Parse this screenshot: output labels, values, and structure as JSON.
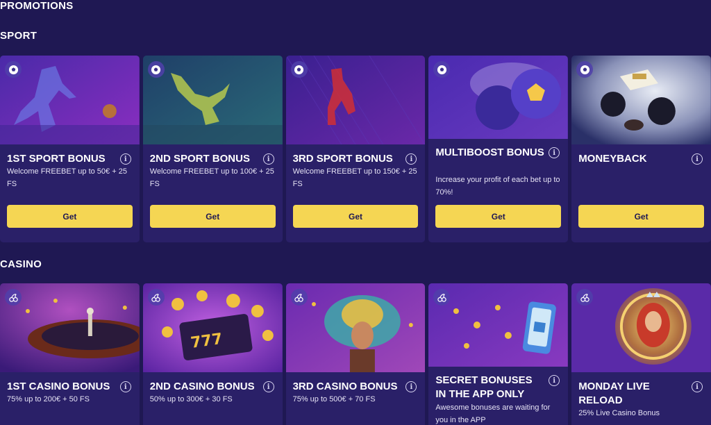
{
  "page": {
    "title": "PROMOTIONS"
  },
  "sport": {
    "title": "SPORT",
    "cards": [
      {
        "title": "1ST SPORT BONUS",
        "desc": "Welcome FREEBET up to 50€ + 25 FS",
        "button": "Get"
      },
      {
        "title": "2ND SPORT BONUS",
        "desc": "Welcome FREEBET up to 100€ + 25 FS",
        "button": "Get"
      },
      {
        "title": "3RD SPORT BONUS",
        "desc": "Welcome FREEBET up to 150€ + 25 FS",
        "button": "Get"
      },
      {
        "title": "MULTIBOOST BONUS",
        "desc": "Increase your profit of each bet up to 70%!",
        "button": "Get"
      },
      {
        "title": "MONEYBACK",
        "desc": "",
        "button": "Get"
      }
    ]
  },
  "casino": {
    "title": "CASINO",
    "cards": [
      {
        "title": "1ST CASINO BONUS",
        "desc": "75% up to 200€ + 50 FS"
      },
      {
        "title": "2ND CASINO BONUS",
        "desc": "50% up to 300€ + 30 FS"
      },
      {
        "title": "3RD CASINO BONUS",
        "desc": "75% up to 500€ + 70 FS"
      },
      {
        "title": "SECRET BONUSES IN THE APP ONLY",
        "desc": "Awesome bonuses are waiting for you in the APP"
      },
      {
        "title": "MONDAY LIVE RELOAD",
        "desc": "25% Live Casino Bonus"
      }
    ]
  },
  "icons": {
    "sport": "soccer-ball-icon",
    "casino": "cherries-icon",
    "info": "info-icon"
  },
  "colors": {
    "background": "#1f1853",
    "card": "#2a2068",
    "button": "#f5d653",
    "button_text": "#1f1853"
  }
}
